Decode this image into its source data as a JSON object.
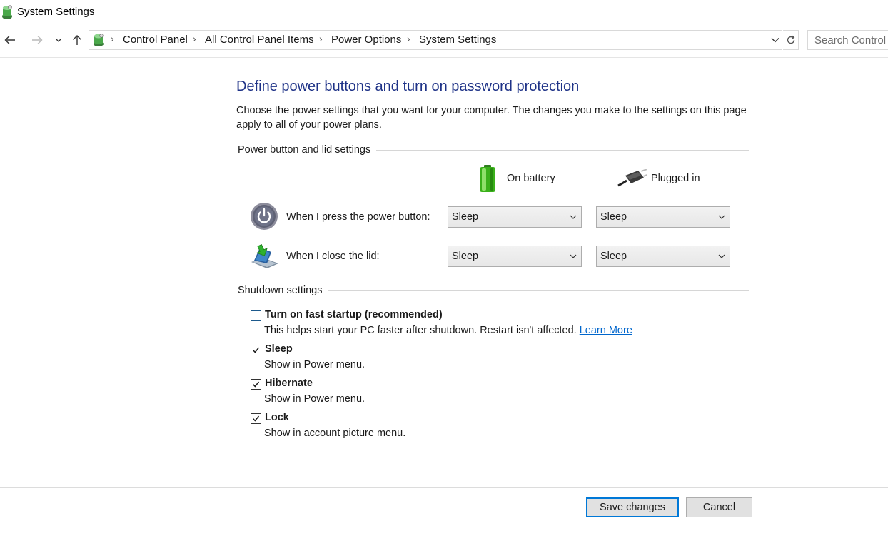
{
  "window": {
    "title": "System Settings",
    "icon": "control-panel-icon"
  },
  "nav": {
    "back_icon": "back-arrow-icon",
    "forward_icon": "forward-arrow-icon",
    "recent_icon": "chevron-down-icon",
    "up_icon": "up-arrow-icon",
    "breadcrumbs": [
      "Control Panel",
      "All Control Panel Items",
      "Power Options",
      "System Settings"
    ],
    "refresh_icon": "refresh-icon",
    "search_placeholder": "Search Control P"
  },
  "main": {
    "heading": "Define power buttons and turn on password protection",
    "intro": "Choose the power settings that you want for your computer. The changes you make to the settings on this page apply to all of your power plans."
  },
  "power_section": {
    "title": "Power button and lid settings",
    "columns": {
      "battery": "On battery",
      "plugged": "Plugged in"
    },
    "rows": [
      {
        "label": "When I press the power button:",
        "icon": "power-button-icon",
        "battery": "Sleep",
        "plugged": "Sleep"
      },
      {
        "label": "When I close the lid:",
        "icon": "laptop-lid-icon",
        "battery": "Sleep",
        "plugged": "Sleep"
      }
    ]
  },
  "shutdown_section": {
    "title": "Shutdown settings",
    "items": [
      {
        "label": "Turn on fast startup (recommended)",
        "desc": "This helps start your PC faster after shutdown. Restart isn't affected.",
        "link": "Learn More",
        "checked": false
      },
      {
        "label": "Sleep",
        "desc": "Show in Power menu.",
        "checked": true
      },
      {
        "label": "Hibernate",
        "desc": "Show in Power menu.",
        "checked": true
      },
      {
        "label": "Lock",
        "desc": "Show in account picture menu.",
        "checked": true
      }
    ]
  },
  "footer": {
    "save_label": "Save changes",
    "cancel_label": "Cancel"
  },
  "colors": {
    "heading": "#1e3287",
    "link": "#0066cc",
    "primary_button_border": "#0078d7"
  }
}
